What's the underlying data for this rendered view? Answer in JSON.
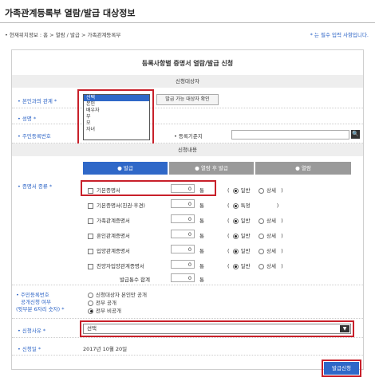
{
  "page": {
    "title": "가족관계등록부 열람/발급 대상정보",
    "breadcrumb": "• 현재위치정보 : 홈 > 열람 / 발급 > 가족관계등록부",
    "required_note": "* 는 필수 입력 사항입니다."
  },
  "form": {
    "title": "등록사항별 증명서 열람/발급 신청",
    "section_applicant": "신청대상자",
    "section_content": "신청내용",
    "relation_label": "• 본인과의 관계 *",
    "relation_options": [
      "선택",
      "본인",
      "배우자",
      "부",
      "모",
      "자녀"
    ],
    "relation_selected": "선택",
    "check_button": "발급 가능 대상자 확인",
    "name_label": "• 성명 *",
    "rrn_label": "• 주민등록번호",
    "regplace_label": "• 등록기준지",
    "doc_type_label": "• 증명서 종류 *",
    "tabs": [
      "● 발급",
      "● 열람 후 발급",
      "● 열람"
    ],
    "docs": [
      {
        "name": "기본증명서",
        "qty": "0",
        "unit": "통",
        "opt1": "일반",
        "opt2": "상세",
        "opt1_on": true
      },
      {
        "name": "기본증명서(친권·후견)",
        "qty": "0",
        "unit": "통",
        "opt1": "특정",
        "opt2": "",
        "opt1_on": true
      },
      {
        "name": "가족관계증명서",
        "qty": "0",
        "unit": "통",
        "opt1": "일반",
        "opt2": "상세",
        "opt1_on": true
      },
      {
        "name": "혼인관계증명서",
        "qty": "0",
        "unit": "통",
        "opt1": "일반",
        "opt2": "상세",
        "opt1_on": true
      },
      {
        "name": "입양관계증명서",
        "qty": "0",
        "unit": "통",
        "opt1": "일반",
        "opt2": "상세",
        "opt1_on": true
      },
      {
        "name": "친양자입양관계증명서",
        "qty": "0",
        "unit": "통",
        "opt1": "일반",
        "opt2": "상세",
        "opt1_on": true
      }
    ],
    "total_label": "발급통수 합계",
    "total_qty": "0",
    "total_unit": "통",
    "rrn_disclose_label1": "• 주민등록번호",
    "rrn_disclose_label2": "공개신청 여부",
    "rrn_disclose_label3": "(뒷부분 6자리 숫자) *",
    "rrn_options": [
      "신청대상자 본인만 공개",
      "전부 공개",
      "전부 비공개"
    ],
    "reason_label": "• 신청사유 *",
    "reason_value": "선택",
    "date_label": "• 신청일 *",
    "date_value": "2017년 10월 20일",
    "submit": "발급신청"
  },
  "colors": {
    "accent": "#2f68c8",
    "highlight": "#c8202a",
    "tab_inactive": "#9a9a9a"
  }
}
